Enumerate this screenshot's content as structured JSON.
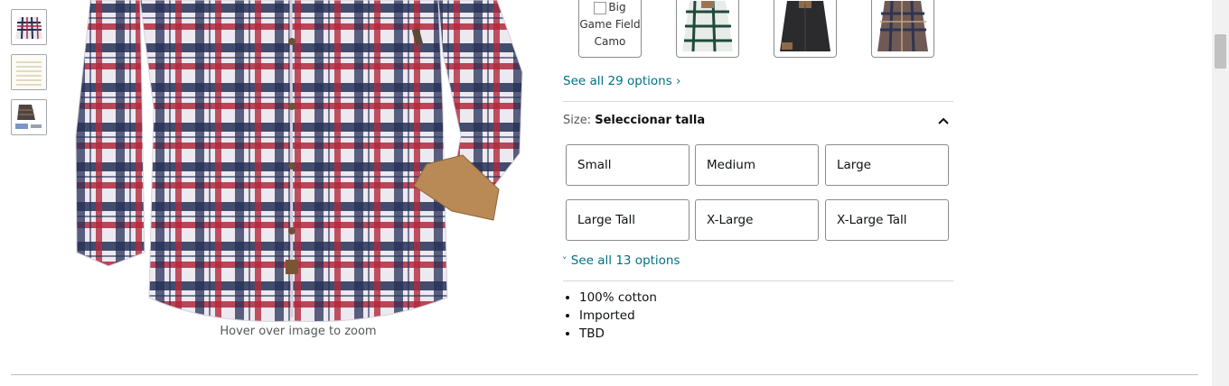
{
  "gallery": {
    "zoom_hint": "Hover over image to zoom"
  },
  "color_options": {
    "broken_swatch_alt": "Big Game Field Camo",
    "see_all_label": "See all 29 options",
    "see_all_chevron": "›"
  },
  "size": {
    "label": "Size:",
    "value": "Seleccionar talla",
    "options": [
      "Small",
      "Medium",
      "Large",
      "Large Tall",
      "X-Large",
      "X-Large Tall"
    ],
    "see_all_label": "See all 13 options",
    "see_all_chevron": "˅"
  },
  "details": {
    "bullets": [
      "100% cotton",
      "Imported",
      "TBD"
    ]
  },
  "colors": {
    "link": "#007185",
    "plaid_red": "#b0283c",
    "plaid_navy": "#263056",
    "cuff_tan": "#b98a55"
  }
}
